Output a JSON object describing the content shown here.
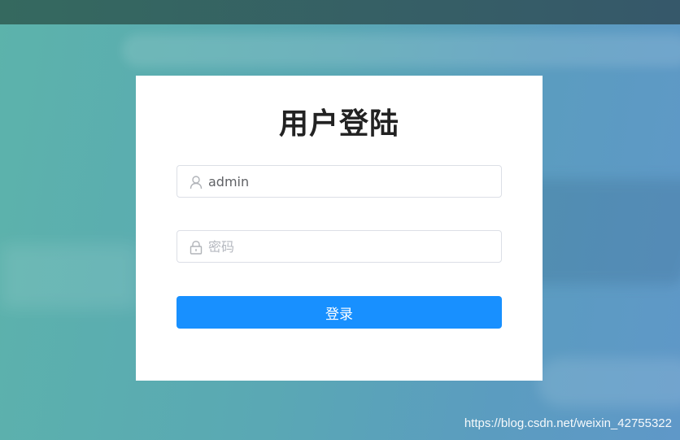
{
  "login": {
    "title": "用户登陆",
    "username": {
      "value": "admin",
      "icon": "user-icon"
    },
    "password": {
      "placeholder": "密码",
      "icon": "lock-icon"
    },
    "submit_label": "登录"
  },
  "watermark": "https://blog.csdn.net/weixin_42755322",
  "colors": {
    "button": "#1890ff",
    "background_start": "#5cb3ab",
    "background_end": "#5f98c8",
    "topbar": "#36606a"
  }
}
